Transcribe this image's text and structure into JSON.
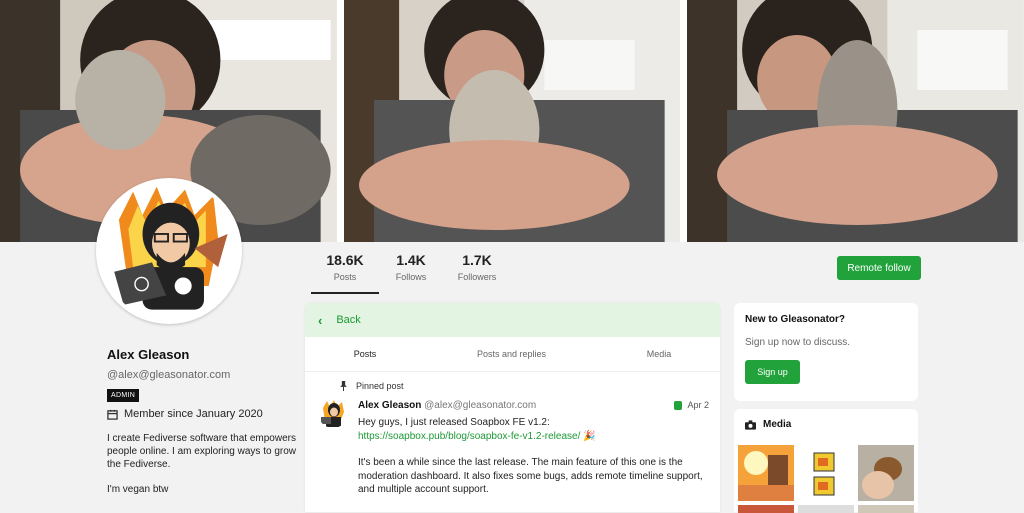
{
  "banner": {
    "photos": [
      "cat-hug-photo-1",
      "cat-hug-photo-2",
      "cat-hug-photo-3"
    ]
  },
  "stats": [
    {
      "value": "18.6K",
      "label": "Posts"
    },
    {
      "value": "1.4K",
      "label": "Follows"
    },
    {
      "value": "1.7K",
      "label": "Followers"
    }
  ],
  "actions": {
    "remote_follow": "Remote follow"
  },
  "profile": {
    "name": "Alex Gleason",
    "handle": "@alex@gleasonator.com",
    "badge": "ADMIN",
    "member_since": "Member since January 2020",
    "bio": "I create Fediverse software that empowers people online. I am exploring ways to grow the Fediverse.",
    "bio_extra": "I'm vegan btw"
  },
  "timeline": {
    "back_label": "Back",
    "tabs": [
      "Posts",
      "Posts and replies",
      "Media"
    ],
    "pinned_label": "Pinned post",
    "post": {
      "author": "Alex Gleason",
      "handle": "@alex@gleasonator.com",
      "date": "Apr 2",
      "text_intro": "Hey guys, I just released Soapbox FE v1.2: ",
      "link": "https://soapbox.pub/blog/soapbox-fe-v1.2-release/",
      "paragraph2": "It's been a while since the last release. The main feature of this one is the moderation dashboard. It also fixes some bugs, adds remote timeline support, and multiple account support."
    }
  },
  "sidebar": {
    "signup_card": {
      "title": "New to Gleasonator?",
      "subtitle": "Sign up now to discuss.",
      "button": "Sign up"
    },
    "media_card": {
      "title": "Media"
    }
  },
  "colors": {
    "accent": "#21a23b",
    "accent_light": "#e3f5e2"
  }
}
